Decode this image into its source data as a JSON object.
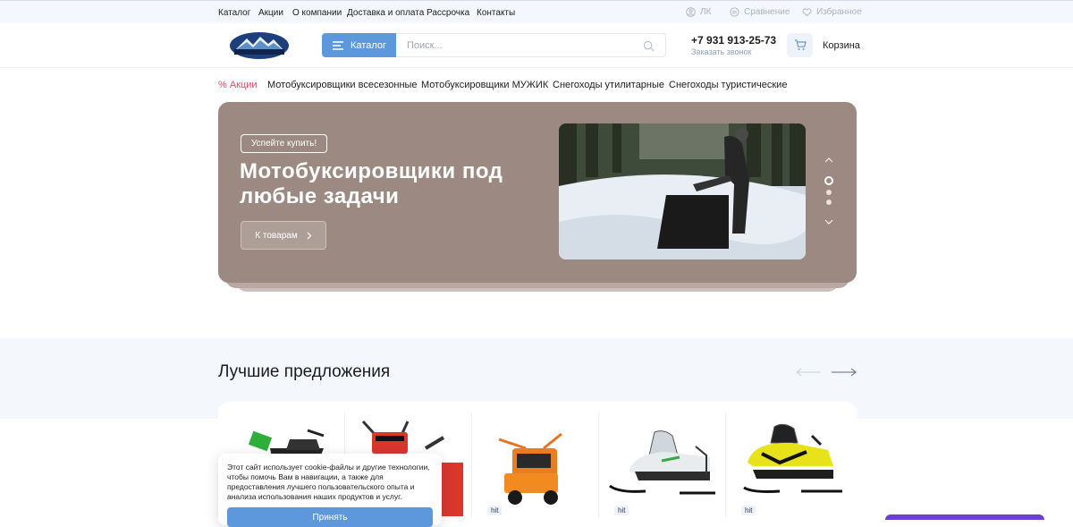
{
  "topbar": {
    "links": [
      "Каталог",
      "Акции",
      "О компании",
      "Доставка и оплата",
      "Рассрочка",
      "Контакты"
    ],
    "account": "ЛК",
    "compare": "Сравнение",
    "favorites": "Избранное"
  },
  "header": {
    "catalog_label": "Каталог",
    "search_placeholder": "Поиск...",
    "phone": "+7 931 913-25-73",
    "callback": "Заказать звонок",
    "cart_label": "Корзина",
    "logo_text": "LEDTERNO"
  },
  "nav": {
    "items": [
      "% Акции",
      "Мотобуксировщики всесезонные",
      "Мотобуксировщики МУЖИК",
      "Снегоходы утилитарные",
      "Снегоходы туристические"
    ]
  },
  "banner": {
    "tag": "Успейте купить!",
    "title": "Мотобуксировщики под любые задачи",
    "button": "К товарам",
    "slide_active": 1,
    "slide_count": 3
  },
  "best": {
    "title": "Лучшие предложения"
  },
  "products": [
    {
      "badge": ""
    },
    {
      "badge": ""
    },
    {
      "badge": "hit"
    },
    {
      "badge": "hit"
    },
    {
      "badge": "hit"
    }
  ],
  "cookie": {
    "text": "Этот сайт использует cookie-файлы и другие технологии, чтобы помочь Вам в навигации, а также для предоставления лучшего пользовательского опыта и анализа использования наших продуктов и услуг.",
    "accept": "Принять"
  },
  "colors": {
    "accent": "#5e98dc",
    "banner_bg": "#9c8a82",
    "promo": "#e24a5f",
    "topbar_bg": "#f4f7fc"
  }
}
